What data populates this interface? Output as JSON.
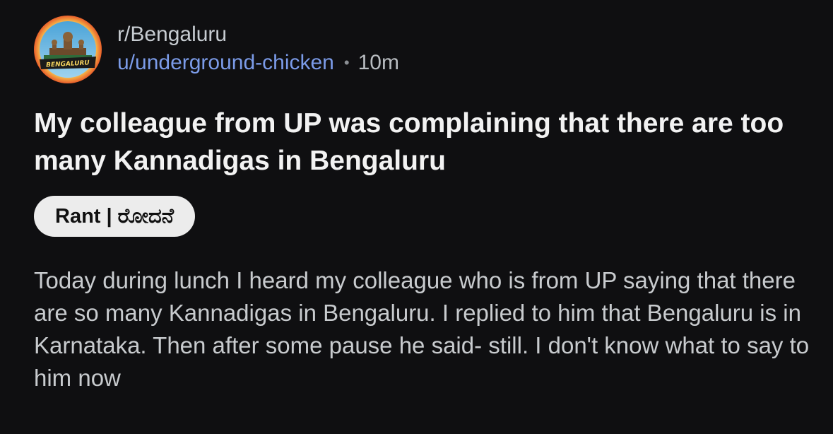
{
  "post": {
    "subreddit": "r/Bengaluru",
    "avatar_label": "BENGALURU",
    "username": "u/underground-chicken",
    "separator": "•",
    "time_ago": "10m",
    "title": "My colleague from UP was complaining that there are too many Kannadigas in Bengaluru",
    "flair": "Rant | ರೋದನೆ",
    "body": "Today during lunch I heard my colleague who is from UP saying that there are so many Kannadigas in Bengaluru. I replied to him that Bengaluru is in Karnataka. Then after some pause he said- still. I don't know what to say to him now"
  },
  "colors": {
    "background": "#0f0f11",
    "username": "#7b9be8",
    "flair_bg": "#ececec",
    "avatar_ring": "#f5a623"
  }
}
